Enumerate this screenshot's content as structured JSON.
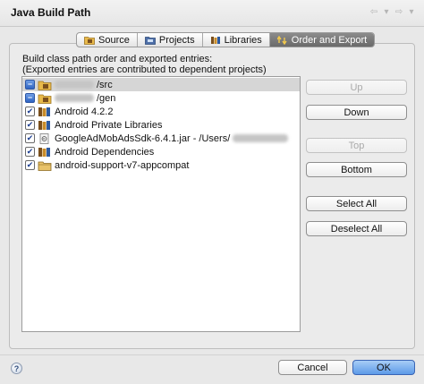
{
  "window": {
    "title": "Java Build Path"
  },
  "tabs": [
    {
      "label": "Source",
      "icon": "source-folder-icon",
      "active": false
    },
    {
      "label": "Projects",
      "icon": "projects-icon",
      "active": false
    },
    {
      "label": "Libraries",
      "icon": "libraries-icon",
      "active": false
    },
    {
      "label": "Order and Export",
      "icon": "order-export-icon",
      "active": true
    }
  ],
  "description": {
    "line1": "Build class path order and exported entries:",
    "line2": "(Exported entries are contributed to dependent projects)"
  },
  "entries": [
    {
      "text": "/src",
      "state": "partial",
      "icon": "source-folder-icon",
      "selected": true
    },
    {
      "text": "/gen",
      "state": "partial",
      "icon": "source-folder-icon",
      "selected": false
    },
    {
      "text": "Android 4.2.2",
      "state": "checked",
      "icon": "library-icon",
      "selected": false
    },
    {
      "text": "Android Private Libraries",
      "state": "checked",
      "icon": "library-icon",
      "selected": false
    },
    {
      "text": "GoogleAdMobAdsSdk-6.4.1.jar - /Users/",
      "state": "checked",
      "icon": "jar-icon",
      "selected": false
    },
    {
      "text": "Android Dependencies",
      "state": "checked",
      "icon": "library-icon",
      "selected": false
    },
    {
      "text": "android-support-v7-appcompat",
      "state": "checked",
      "icon": "project-folder-icon",
      "selected": false
    }
  ],
  "buttons": {
    "up": "Up",
    "down": "Down",
    "top": "Top",
    "bottom": "Bottom",
    "select_all": "Select All",
    "deselect_all": "Deselect All"
  },
  "footer": {
    "help": "?",
    "cancel": "Cancel",
    "ok": "OK"
  },
  "colors": {
    "selection": "#d6d6d6",
    "ok_button": "#5d9ae8",
    "checkbox_partial": "#2f64c2"
  }
}
